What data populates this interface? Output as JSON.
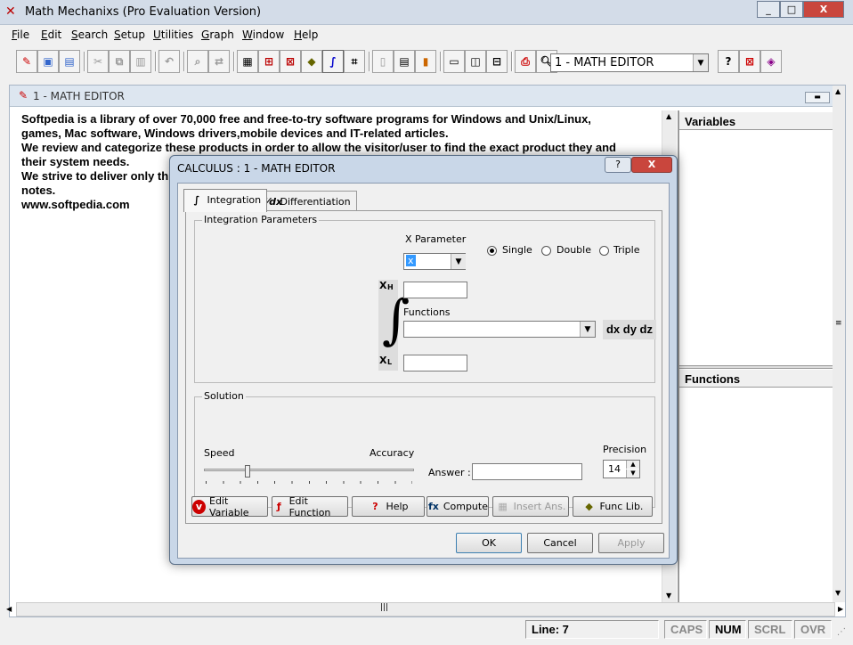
{
  "app": {
    "title": "Math Mechanixs (Pro Evaluation Version)",
    "icon": "math-mechanixs-app-icon"
  },
  "window_controls": {
    "minimize": "_",
    "maximize": "□",
    "close": "X"
  },
  "menu": [
    {
      "label": "File"
    },
    {
      "label": "Edit"
    },
    {
      "label": "Search"
    },
    {
      "label": "Setup"
    },
    {
      "label": "Utilities"
    },
    {
      "label": "Graph"
    },
    {
      "label": "Window"
    },
    {
      "label": "Help"
    }
  ],
  "toolbar": {
    "document_selector": "1 - MATH EDITOR",
    "icons": [
      "pencil-icon",
      "new-window-icon",
      "open-window-icon",
      "cut-icon",
      "copy-icon",
      "paste-icon",
      "undo-icon",
      "find-icon",
      "replace-icon",
      "calculator-icon",
      "matrix-icon",
      "stats-icon",
      "stamp-icon",
      "calculus-icon",
      "graph-icon",
      "page-icon",
      "table-icon",
      "bar-chart-icon",
      "grid-icon",
      "tile-icon",
      "split-icon",
      "print-icon",
      "print-preview-icon",
      "context-help-icon",
      "function-library-icon",
      "book-icon"
    ]
  },
  "child_window": {
    "title": "1 - MATH EDITOR"
  },
  "editor": {
    "lines": [
      "Softpedia is a library of over 70,000 free and free-to-try software programs for Windows and Unix/Linux,",
      "games, Mac software, Windows drivers,mobile devices and IT-related articles.",
      "We review and categorize these products in order to allow the visitor/user to find the exact product they and",
      "their system needs.",
      "We strive to deliver only th",
      "notes.",
      "www.softpedia.com"
    ]
  },
  "side_panels": {
    "variables": "Variables",
    "functions": "Functions"
  },
  "status": {
    "line": "Line: 7",
    "caps": "CAPS",
    "num": "NUM",
    "scrl": "SCRL",
    "ovr": "OVR"
  },
  "dialog": {
    "title": "CALCULUS : 1 - MATH EDITOR",
    "help_button": "?",
    "close_button": "X",
    "tabs": [
      {
        "label": "Integration"
      },
      {
        "label": "Differentiation"
      }
    ],
    "integration": {
      "group_label": "Integration Parameters",
      "x_parameter_label": "X Parameter",
      "x_parameter_value": "x",
      "modes": [
        {
          "label": "Single",
          "selected": true
        },
        {
          "label": "Double",
          "selected": false
        },
        {
          "label": "Triple",
          "selected": false
        }
      ],
      "xh_label": "X",
      "xh_sub": "H",
      "xl_label": "X",
      "xl_sub": "L",
      "functions_label": "Functions",
      "differential_label": "dx dy dz"
    },
    "solution": {
      "group_label": "Solution",
      "speed_label": "Speed",
      "accuracy_label": "Accuracy",
      "slider_position": 0.2,
      "answer_label": "Answer :",
      "precision_label": "Precision",
      "precision_value": "14"
    },
    "actions": [
      {
        "label": "Edit Variable",
        "icon": "edit-variable-icon",
        "enabled": true
      },
      {
        "label": "Edit Function",
        "icon": "edit-function-icon",
        "enabled": true
      },
      {
        "label": "Help",
        "icon": "help-icon",
        "enabled": true
      },
      {
        "label": "Compute",
        "icon": "compute-icon",
        "enabled": true
      },
      {
        "label": "Insert Ans.",
        "icon": "insert-answer-icon",
        "enabled": false
      },
      {
        "label": "Func Lib.",
        "icon": "function-library-icon",
        "enabled": true
      }
    ],
    "footer": {
      "ok": "OK",
      "cancel": "Cancel",
      "apply": "Apply"
    }
  }
}
